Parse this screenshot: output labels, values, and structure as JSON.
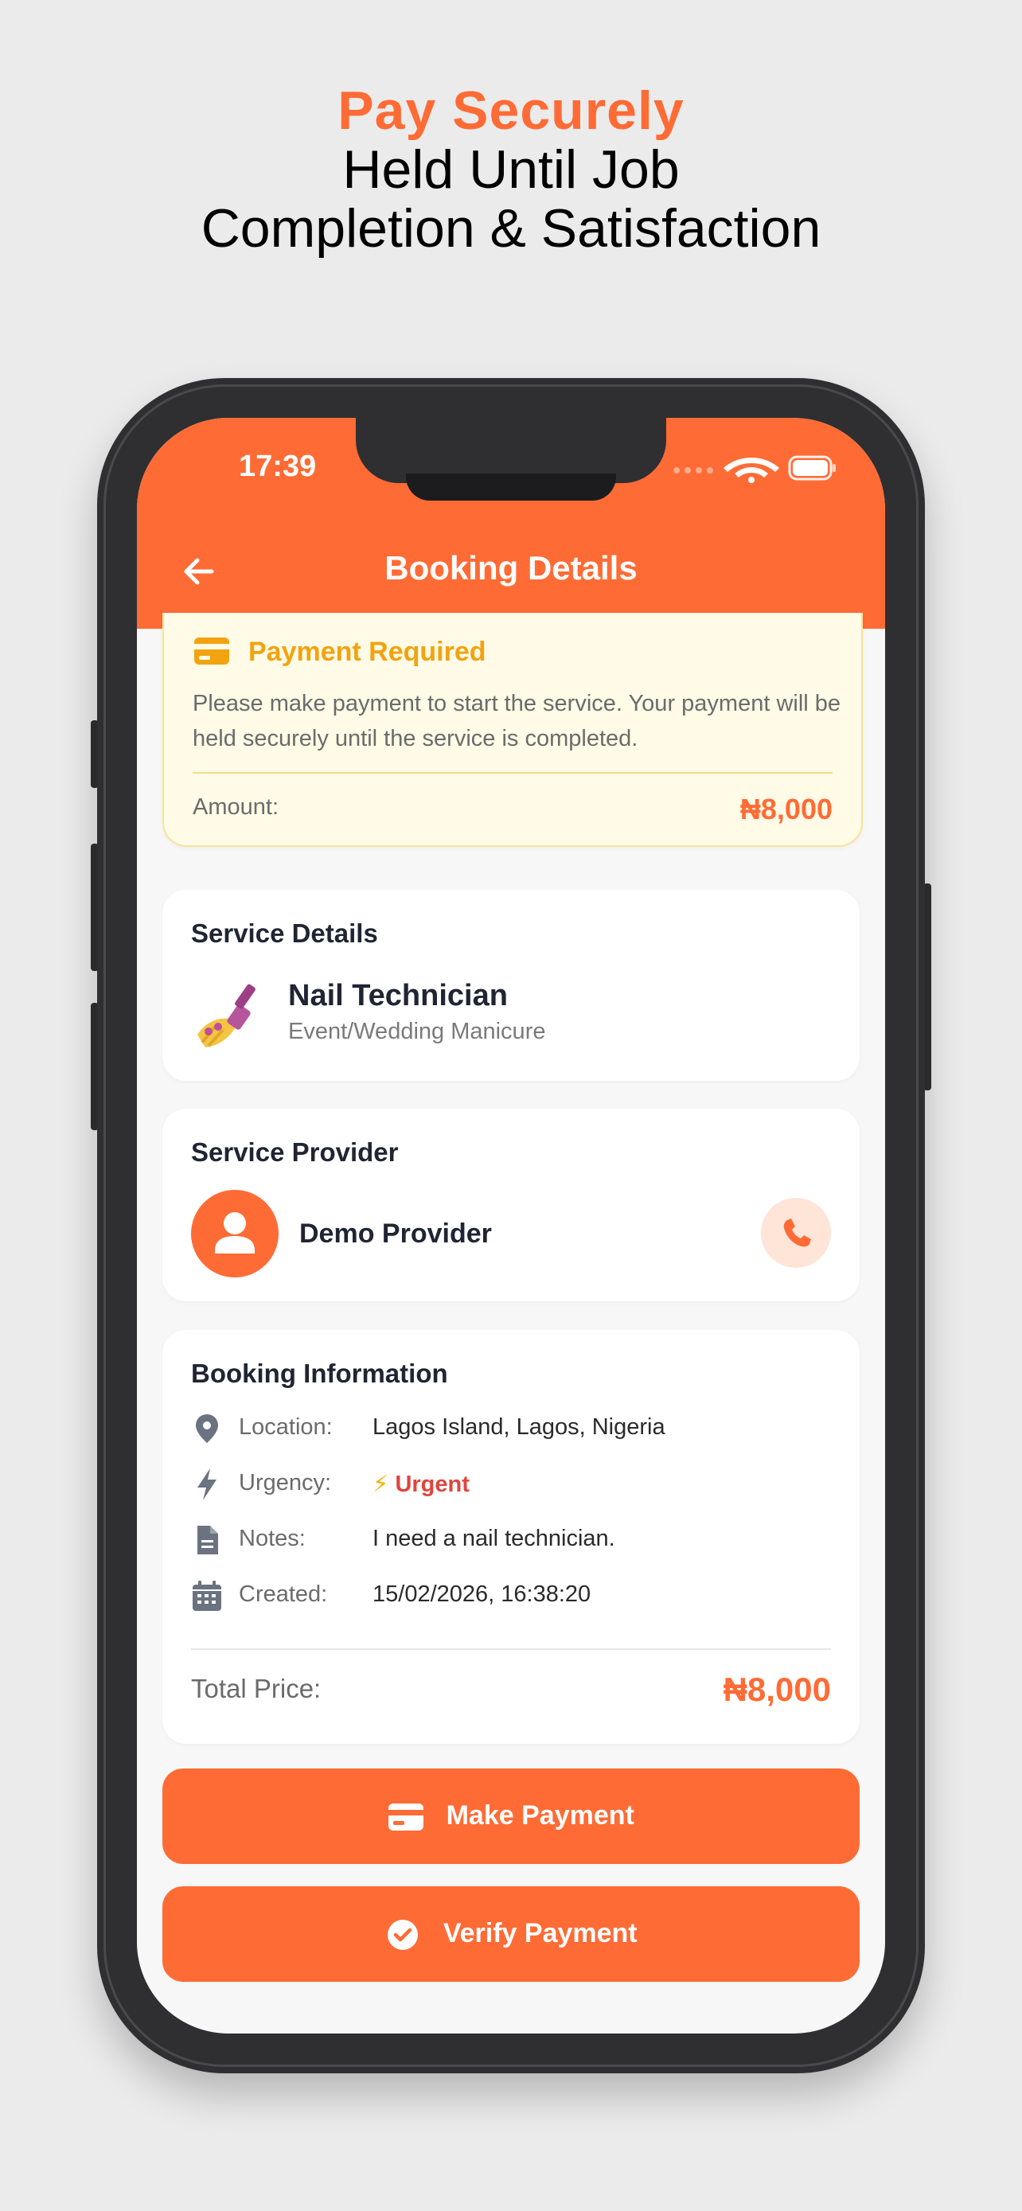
{
  "promo": {
    "line1": "Pay Securely",
    "line2": "Held Until Job",
    "line3": "Completion & Satisfaction"
  },
  "status_bar": {
    "time": "17:39"
  },
  "header": {
    "title": "Booking Details",
    "back_icon": "arrow-left-icon"
  },
  "payment": {
    "title": "Payment Required",
    "message": "Please make payment to start the service. Your payment will be held securely until the service is completed.",
    "amount_label": "Amount:",
    "amount": "₦8,000"
  },
  "service": {
    "section_title": "Service Details",
    "emoji": "💅",
    "name": "Nail Technician",
    "subtitle": "Event/Wedding Manicure"
  },
  "provider": {
    "section_title": "Service Provider",
    "name": "Demo Provider"
  },
  "booking_info": {
    "section_title": "Booking Information",
    "location": {
      "label": "Location:",
      "value": "Lagos Island, Lagos, Nigeria"
    },
    "urgency": {
      "label": "Urgency:",
      "value": "Urgent",
      "prefix": "⚡"
    },
    "notes": {
      "label": "Notes:",
      "value": "I need a nail technician."
    },
    "created": {
      "label": "Created:",
      "value": "15/02/2026, 16:38:20"
    },
    "total_label": "Total Price:",
    "total_value": "₦8,000"
  },
  "actions": {
    "make_payment": "Make Payment",
    "verify_payment": "Verify Payment"
  },
  "colors": {
    "accent": "#ff6b35",
    "warning": "#f2a30f",
    "urgent": "#e0453c"
  }
}
